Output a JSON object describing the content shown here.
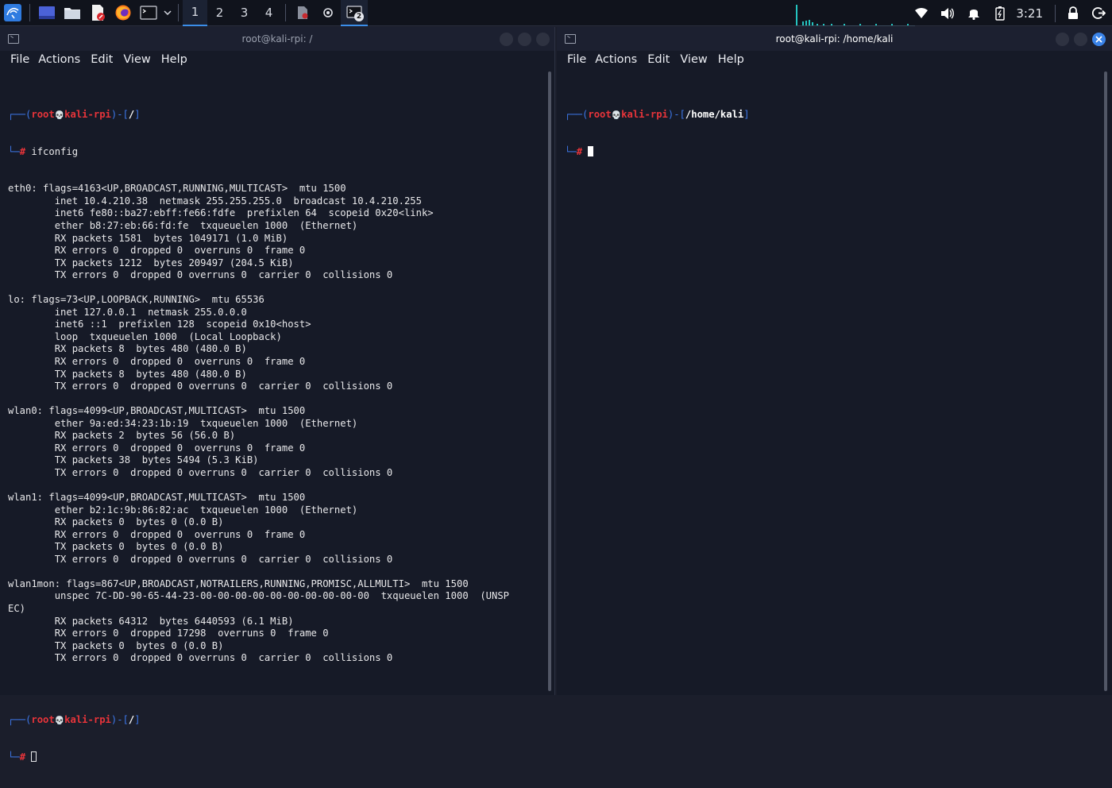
{
  "panel": {
    "workspaces": [
      "1",
      "2",
      "3",
      "4"
    ],
    "active_workspace": "1",
    "active_task_badge": "2",
    "clock": "3:21",
    "accent": "#3b8ee9",
    "cpu_color": "#24c4c0"
  },
  "left_window": {
    "title": "root@kali-rpi: /",
    "menu": [
      "File",
      "Actions",
      "Edit",
      "View",
      "Help"
    ],
    "prompt_user": "root",
    "prompt_host": "kali-rpi",
    "prompt_dir": "/",
    "command": "ifconfig",
    "output": [
      "eth0: flags=4163<UP,BROADCAST,RUNNING,MULTICAST>  mtu 1500",
      "        inet 10.4.210.38  netmask 255.255.255.0  broadcast 10.4.210.255",
      "        inet6 fe80::ba27:ebff:fe66:fdfe  prefixlen 64  scopeid 0x20<link>",
      "        ether b8:27:eb:66:fd:fe  txqueuelen 1000  (Ethernet)",
      "        RX packets 1581  bytes 1049171 (1.0 MiB)",
      "        RX errors 0  dropped 0  overruns 0  frame 0",
      "        TX packets 1212  bytes 209497 (204.5 KiB)",
      "        TX errors 0  dropped 0 overruns 0  carrier 0  collisions 0",
      "",
      "lo: flags=73<UP,LOOPBACK,RUNNING>  mtu 65536",
      "        inet 127.0.0.1  netmask 255.0.0.0",
      "        inet6 ::1  prefixlen 128  scopeid 0x10<host>",
      "        loop  txqueuelen 1000  (Local Loopback)",
      "        RX packets 8  bytes 480 (480.0 B)",
      "        RX errors 0  dropped 0  overruns 0  frame 0",
      "        TX packets 8  bytes 480 (480.0 B)",
      "        TX errors 0  dropped 0 overruns 0  carrier 0  collisions 0",
      "",
      "wlan0: flags=4099<UP,BROADCAST,MULTICAST>  mtu 1500",
      "        ether 9a:ed:34:23:1b:19  txqueuelen 1000  (Ethernet)",
      "        RX packets 2  bytes 56 (56.0 B)",
      "        RX errors 0  dropped 0  overruns 0  frame 0",
      "        TX packets 38  bytes 5494 (5.3 KiB)",
      "        TX errors 0  dropped 0 overruns 0  carrier 0  collisions 0",
      "",
      "wlan1: flags=4099<UP,BROADCAST,MULTICAST>  mtu 1500",
      "        ether b2:1c:9b:86:82:ac  txqueuelen 1000  (Ethernet)",
      "        RX packets 0  bytes 0 (0.0 B)",
      "        RX errors 0  dropped 0  overruns 0  frame 0",
      "        TX packets 0  bytes 0 (0.0 B)",
      "        TX errors 0  dropped 0 overruns 0  carrier 0  collisions 0",
      "",
      "wlan1mon: flags=867<UP,BROADCAST,NOTRAILERS,RUNNING,PROMISC,ALLMULTI>  mtu 1500",
      "        unspec 7C-DD-90-65-44-23-00-00-00-00-00-00-00-00-00-00  txqueuelen 1000  (UNSP",
      "EC)",
      "        RX packets 64312  bytes 6440593 (6.1 MiB)",
      "        RX errors 0  dropped 17298  overruns 0  frame 0",
      "        TX packets 0  bytes 0 (0.0 B)",
      "        TX errors 0  dropped 0 overruns 0  carrier 0  collisions 0",
      "",
      ""
    ]
  },
  "right_window": {
    "title": "root@kali-rpi: /home/kali",
    "menu": [
      "File",
      "Actions",
      "Edit",
      "View",
      "Help"
    ],
    "prompt_user": "root",
    "prompt_host": "kali-rpi",
    "prompt_dir": "/home/kali"
  },
  "prompt_glyphs": {
    "open": "┌──(",
    "skull": "💀",
    "mid": ")-[",
    "close": "]",
    "second": "└─",
    "hash": "#"
  }
}
